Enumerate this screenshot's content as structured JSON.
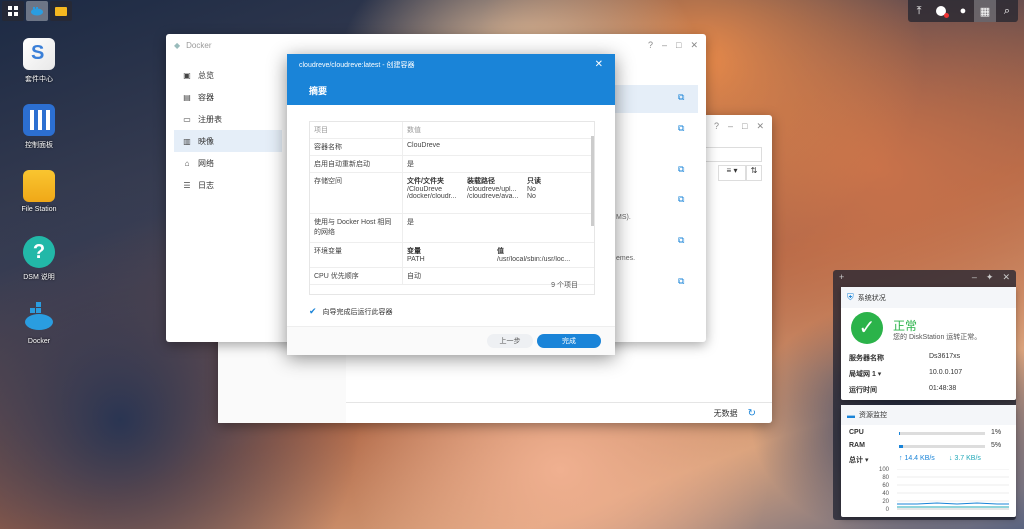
{
  "desktop": {
    "icons": [
      {
        "label": "套件中心",
        "icon": "package-center-icon"
      },
      {
        "label": "控制面板",
        "icon": "control-panel-icon"
      },
      {
        "label": "File Station",
        "icon": "folder-icon"
      },
      {
        "label": "DSM 说明",
        "icon": "help-icon"
      },
      {
        "label": "Docker",
        "icon": "docker-icon"
      }
    ]
  },
  "docker_window": {
    "title": "Docker",
    "sidebar": [
      {
        "label": "总览",
        "icon": "overview-icon"
      },
      {
        "label": "容器",
        "icon": "container-icon"
      },
      {
        "label": "注册表",
        "icon": "registry-icon"
      },
      {
        "label": "映像",
        "icon": "image-icon"
      },
      {
        "label": "网络",
        "icon": "network-icon"
      },
      {
        "label": "日志",
        "icon": "log-icon"
      }
    ],
    "fragments": [
      "MS).",
      "emes."
    ]
  },
  "back_window": {
    "footer_text": "无数据"
  },
  "modal": {
    "title": "cloudreve/cloudreve:latest - 创建容器",
    "heading": "摘要",
    "columns": [
      "项目",
      "数值"
    ],
    "rows": {
      "name_key": "容器名称",
      "name_val": "ClouDreve",
      "auto_key": "启用自动重新启动",
      "auto_val": "是",
      "storage_key": "存储空间",
      "storage_headers": [
        "文件/文件夹",
        "装载路径",
        "只读"
      ],
      "storage_rows": [
        [
          "/ClouDreve",
          "/cloudreve/upl...",
          "No"
        ],
        [
          "/docker/cloudr...",
          "/cloudreve/ava...",
          "No"
        ]
      ],
      "net_key": "使用与 Docker Host 相同的网络",
      "net_val": "是",
      "env_key": "环境变量",
      "env_headers": [
        "变量",
        "值"
      ],
      "env_row": [
        "PATH",
        "/usr/local/sbin:/usr/loc..."
      ],
      "cpu_key": "CPU 优先顺序",
      "cpu_val": "自动"
    },
    "count_text": "9 个项目",
    "checkbox_label": "向导完成后运行此容器",
    "back_label": "上一步",
    "done_label": "完成"
  },
  "system_health": {
    "title": "系统状况",
    "status": "正常",
    "status_desc": "您的 DiskStation 运转正常。",
    "server_name_key": "服务器名称",
    "server_name_val": "Ds3617xs",
    "lan_key": "局域网 1 ▾",
    "lan_val": "10.0.0.107",
    "uptime_key": "运行时间",
    "uptime_val": "01:48:38"
  },
  "resource_monitor": {
    "title": "资源监控",
    "cpu_label": "CPU",
    "cpu_val": "1%",
    "cpu_pct": 1,
    "ram_label": "RAM",
    "ram_val": "5%",
    "ram_pct": 5,
    "net_label": "总计 ▾",
    "up": "14.4 KB/s",
    "down": "3.7 KB/s",
    "y_ticks": [
      "100",
      "80",
      "60",
      "40",
      "20",
      "0"
    ]
  }
}
